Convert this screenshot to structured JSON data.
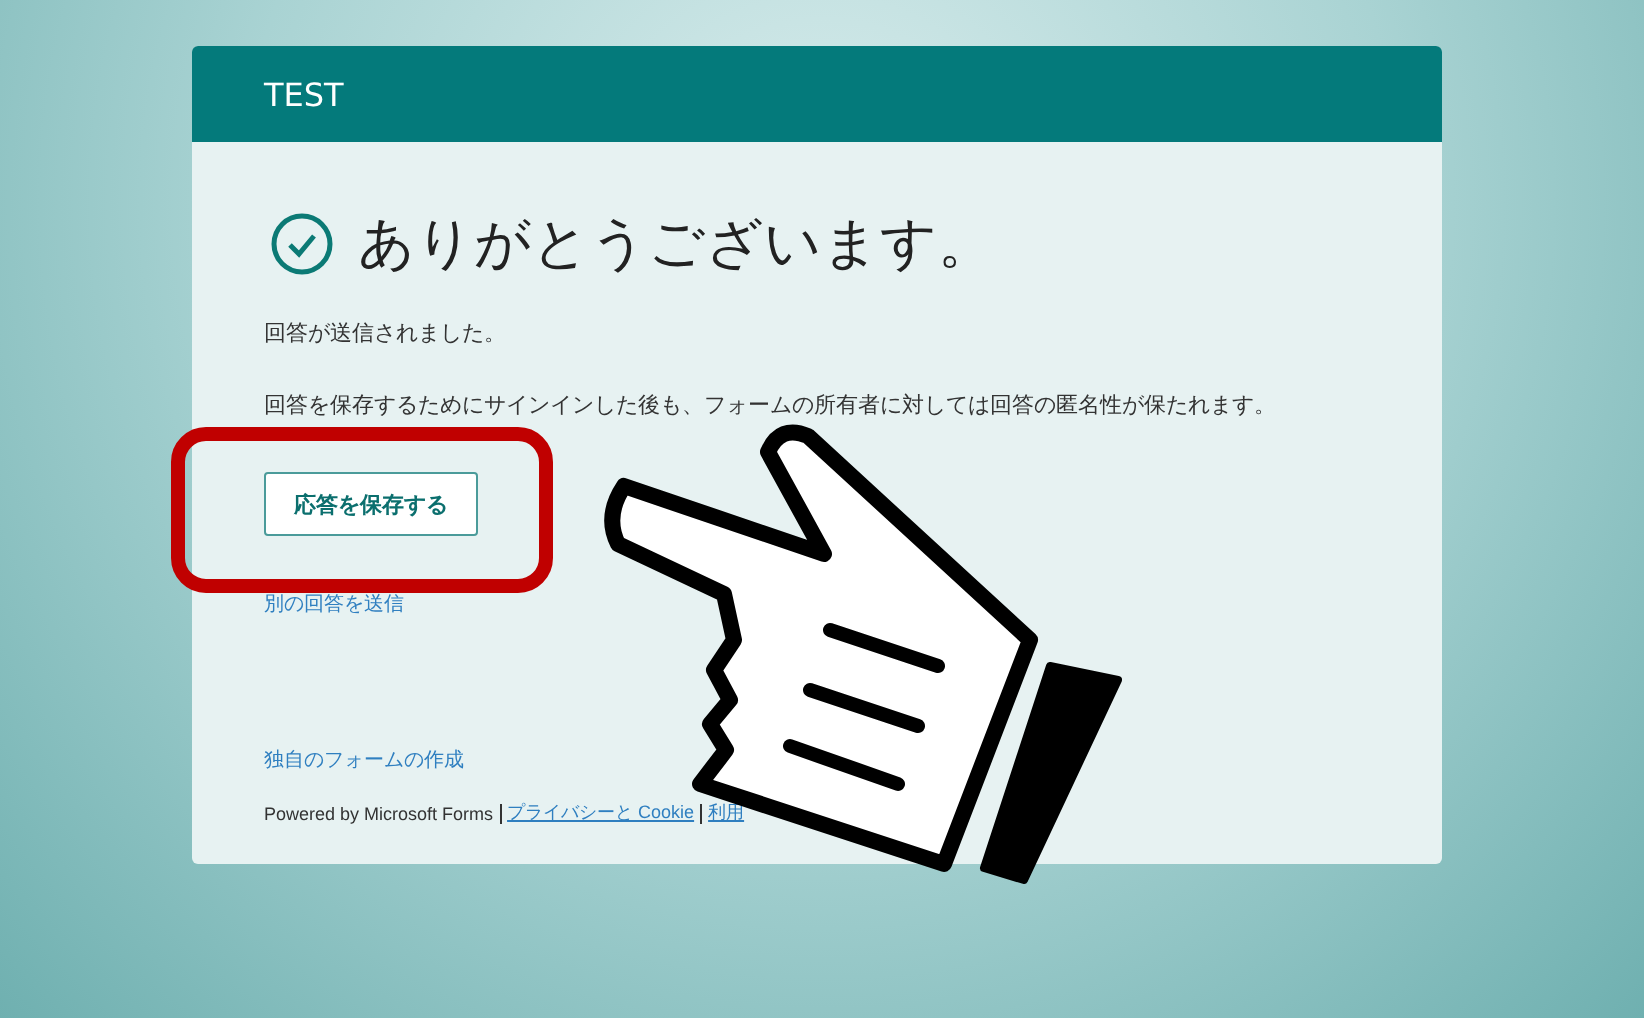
{
  "form": {
    "title": "TEST"
  },
  "confirmation": {
    "heading": "ありがとうございます。",
    "message": "回答が送信されました。",
    "note": "回答を保存するためにサインインした後も、フォームの所有者に対しては回答の匿名性が保たれます。"
  },
  "save_button": "応答を保存する",
  "another_response_link": "別の回答を送信",
  "create_form_link": "独自のフォームの作成",
  "footer": {
    "powered_by": "Powered by Microsoft Forms",
    "links": [
      "プライバシーと Cookie",
      "利用"
    ]
  }
}
